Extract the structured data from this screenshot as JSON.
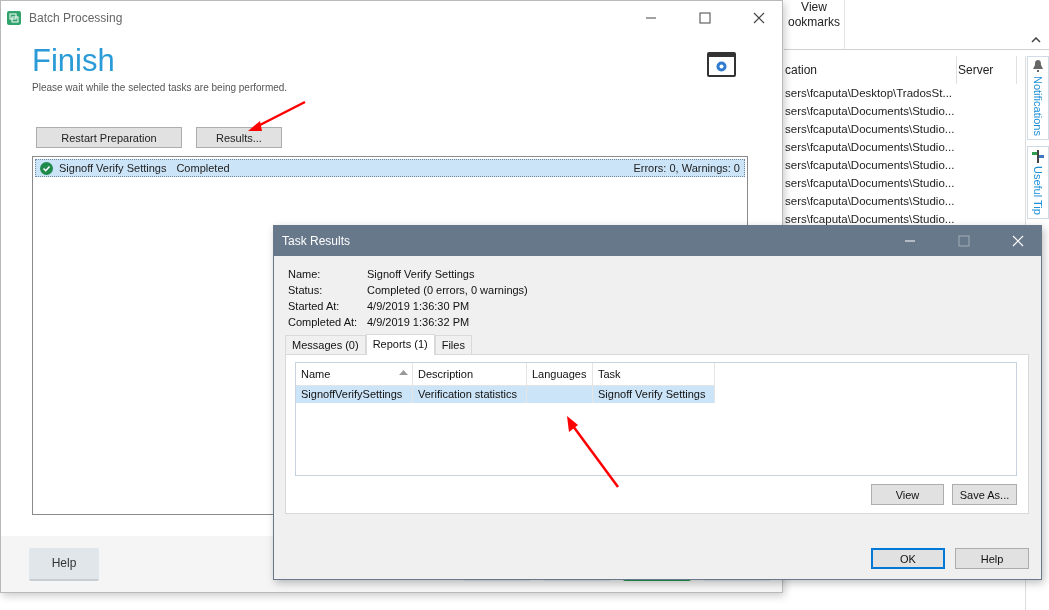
{
  "background_app": {
    "ribbon_label": [
      "View",
      "ookmarks"
    ],
    "table": {
      "columns": [
        "cation",
        "Server"
      ],
      "rows": [
        "sers\\fcaputa\\Desktop\\TradosSt...",
        "sers\\fcaputa\\Documents\\Studio...",
        "sers\\fcaputa\\Documents\\Studio...",
        "sers\\fcaputa\\Documents\\Studio...",
        "sers\\fcaputa\\Documents\\Studio...",
        "sers\\fcaputa\\Documents\\Studio...",
        "sers\\fcaputa\\Documents\\Studio...",
        "sers\\fcaputa\\Documents\\Studio..."
      ]
    },
    "side_tabs": [
      {
        "label": "Notifications",
        "kind": "bell"
      },
      {
        "label": "Useful Tip",
        "kind": "signpost"
      }
    ]
  },
  "batch_window": {
    "title": "Batch Processing",
    "heading": "Finish",
    "subtitle": "Please wait while the selected tasks are being performed.",
    "buttons": [
      "Restart Preparation",
      "Results..."
    ],
    "tasks": [
      {
        "name": "Signoff Verify Settings",
        "status": "Completed",
        "summary": "Errors: 0, Warnings: 0",
        "selected": true
      }
    ],
    "help_button": "Help"
  },
  "task_results": {
    "title": "Task Results",
    "fields": [
      {
        "label": "Name:",
        "value": "Signoff Verify Settings"
      },
      {
        "label": "Status:",
        "value": "Completed (0 errors, 0 warnings)"
      },
      {
        "label": "Started At:",
        "value": "4/9/2019 1:36:30 PM"
      },
      {
        "label": "Completed At:",
        "value": "4/9/2019 1:36:32 PM"
      }
    ],
    "tabs": [
      {
        "label": "Messages (0)",
        "selected": false
      },
      {
        "label": "Reports (1)",
        "selected": true
      },
      {
        "label": "Files",
        "selected": false
      }
    ],
    "columns": [
      {
        "label": "Name",
        "sorted": true
      },
      {
        "label": "Description",
        "sorted": false
      },
      {
        "label": "Languages",
        "sorted": false
      },
      {
        "label": "Task",
        "sorted": false
      }
    ],
    "rows": [
      {
        "cells": [
          "SignoffVerifySettings",
          "Verification statistics",
          "",
          "Signoff Verify Settings"
        ],
        "selected": true
      }
    ],
    "panel_buttons": [
      "View",
      "Save As..."
    ],
    "buttons": [
      {
        "label": "OK",
        "default": true
      },
      {
        "label": "Help",
        "default": false
      }
    ]
  }
}
